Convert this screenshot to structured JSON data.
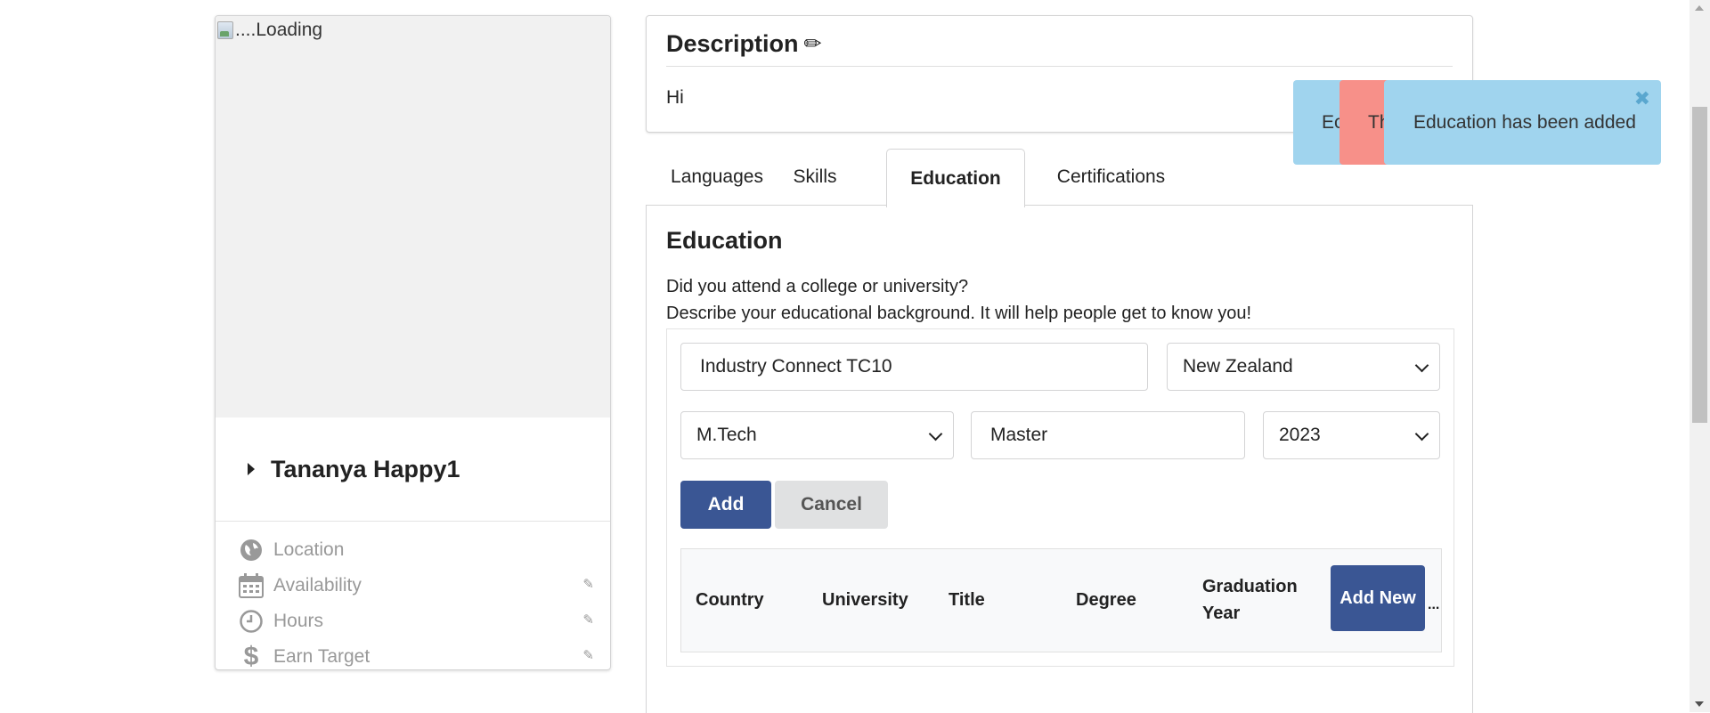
{
  "profile": {
    "photo_alt": "....Loading",
    "name": "Tananya Happy1",
    "details": [
      {
        "label": "Location",
        "icon": "globe-icon",
        "editable": false
      },
      {
        "label": "Availability",
        "icon": "calendar-icon",
        "editable": true
      },
      {
        "label": "Hours",
        "icon": "clock-icon",
        "editable": true
      },
      {
        "label": "Earn Target",
        "icon": "dollar-icon",
        "editable": true
      }
    ]
  },
  "description": {
    "title": "Description",
    "text": "Hi"
  },
  "tabs": [
    {
      "label": "Languages",
      "active": false
    },
    {
      "label": "Skills",
      "active": false
    },
    {
      "label": "Education",
      "active": true
    },
    {
      "label": "Certifications",
      "active": false
    }
  ],
  "education": {
    "heading": "Education",
    "question": "Did you attend a college or university?",
    "subtext": "Describe your educational background. It will help people get to know you!",
    "form": {
      "university": "Industry Connect TC10",
      "country": "New Zealand",
      "title": "M.Tech",
      "degree": "Master",
      "graduation_year": "2023",
      "add_label": "Add",
      "cancel_label": "Cancel"
    },
    "table": {
      "columns": [
        "Country",
        "University",
        "Title",
        "Degree",
        "Graduation Year"
      ],
      "add_new_label": "Add New",
      "overflow": "..."
    }
  },
  "toasts": [
    {
      "text": "Education has been added",
      "type": "info",
      "visible_fragment": "Ec"
    },
    {
      "text": "Th",
      "type": "error",
      "visible_fragment": "Th"
    },
    {
      "text": "Education has been added",
      "type": "info",
      "visible_fragment": "Education has been added"
    }
  ],
  "colors": {
    "primary": "#3a5694",
    "toast_info": "#a0d4ee",
    "toast_error": "#f79089",
    "muted": "#999999"
  }
}
